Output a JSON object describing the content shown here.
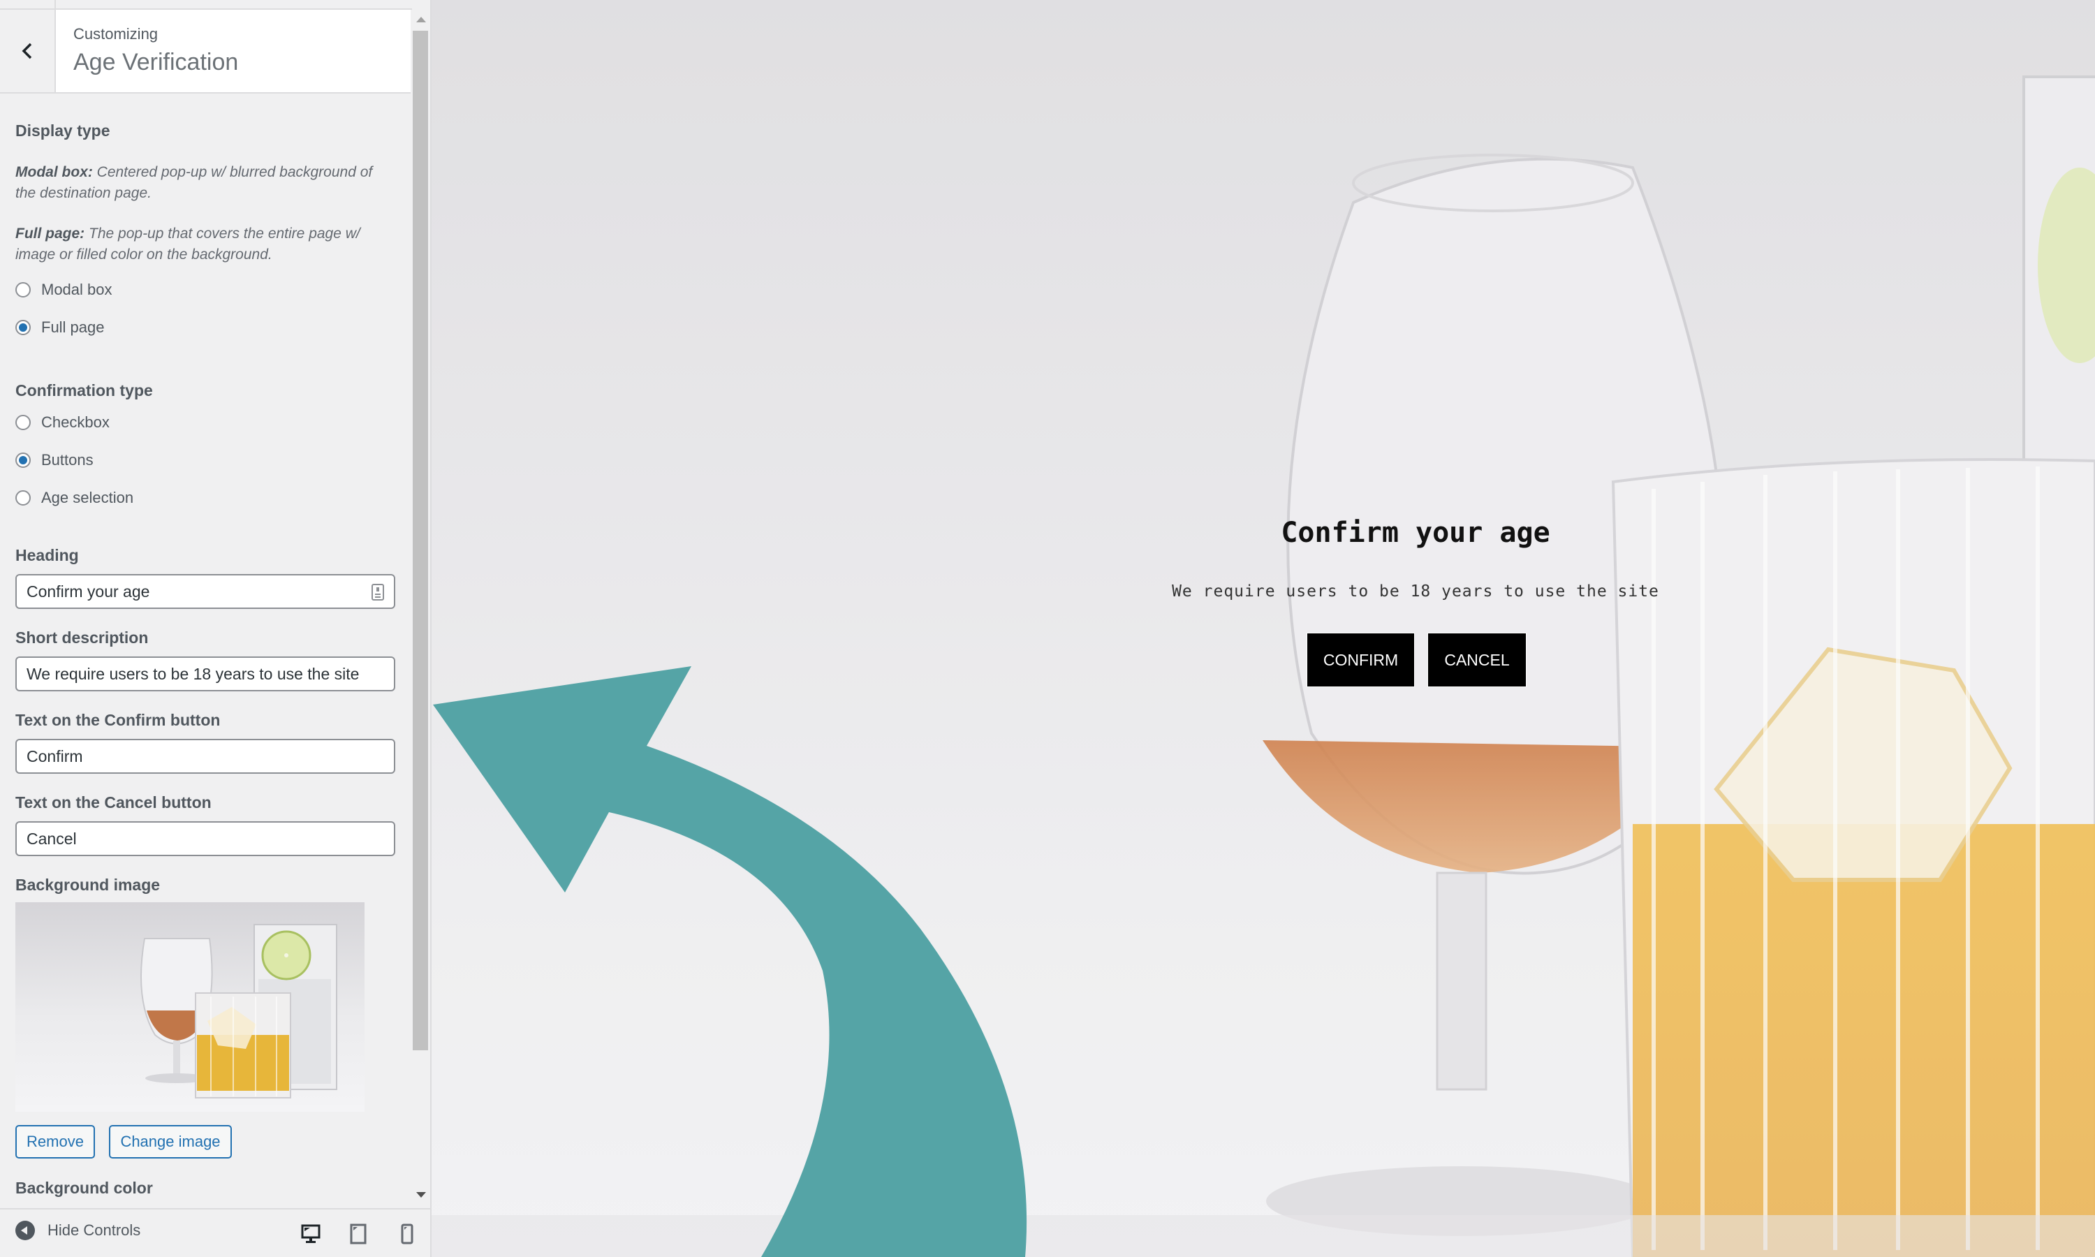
{
  "sidebar": {
    "header": {
      "back_icon": "chevron-left-icon",
      "subtitle": "Customizing",
      "title": "Age Verification"
    },
    "display_type": {
      "label": "Display type",
      "modal_desc_bold": "Modal box:",
      "modal_desc": " Centered pop-up w/ blurred background of the destination page.",
      "full_desc_bold": "Full page:",
      "full_desc": " The pop-up that covers the entire page w/ image or filled color on the background.",
      "options": [
        {
          "label": "Modal box",
          "checked": false
        },
        {
          "label": "Full page",
          "checked": true
        }
      ]
    },
    "confirmation_type": {
      "label": "Confirmation type",
      "options": [
        {
          "label": "Checkbox",
          "checked": false
        },
        {
          "label": "Buttons",
          "checked": true
        },
        {
          "label": "Age selection",
          "checked": false
        }
      ]
    },
    "fields": {
      "heading": {
        "label": "Heading",
        "value": "Confirm your age",
        "icon": "form-fill-icon"
      },
      "short_description": {
        "label": "Short description",
        "value": "We require users to be 18 years to use the site"
      },
      "confirm_text": {
        "label": "Text on the Confirm button",
        "value": "Confirm"
      },
      "cancel_text": {
        "label": "Text on the Cancel button",
        "value": "Cancel"
      }
    },
    "background_image": {
      "label": "Background image",
      "remove_label": "Remove",
      "change_label": "Change image"
    },
    "background_color": {
      "label": "Background color"
    },
    "footer": {
      "hide_controls_label": "Hide Controls",
      "devices": [
        {
          "name": "desktop",
          "active": true
        },
        {
          "name": "tablet",
          "active": false
        },
        {
          "name": "mobile",
          "active": false
        }
      ]
    }
  },
  "preview": {
    "dialog": {
      "heading": "Confirm your age",
      "description": "We require users to be 18 years to use the site",
      "confirm_label": "CONFIRM",
      "cancel_label": "CANCEL"
    }
  },
  "colors": {
    "accent": "#2271b1",
    "annotation_arrow": "#55a4a6",
    "dialog_button_bg": "#000000"
  }
}
